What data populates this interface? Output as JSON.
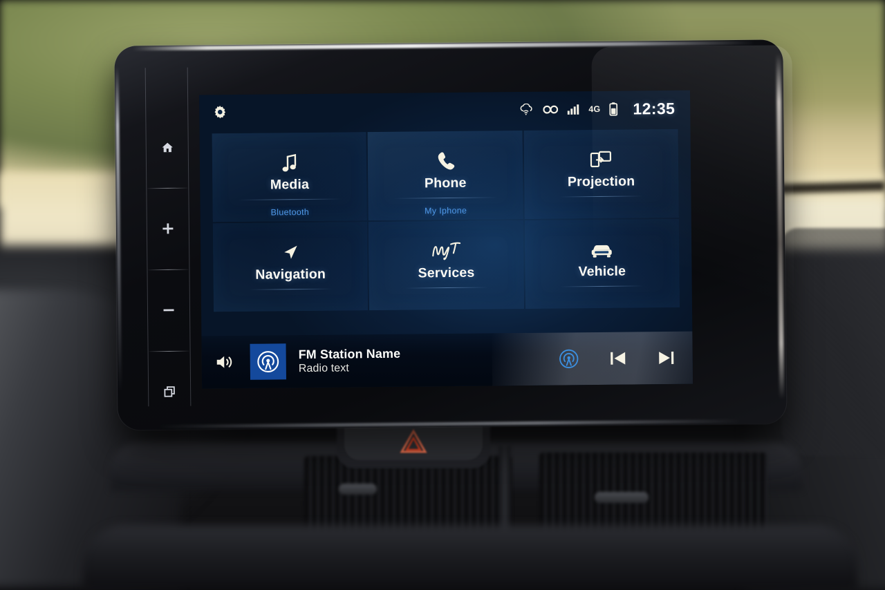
{
  "device": {
    "name": "toyota-touch-infotainment-head-unit",
    "accent_blue": "#14499c",
    "subtitle_blue": "#4f97e6",
    "icon_cream": "#f6f2e2"
  },
  "bezel": {
    "buttons": [
      {
        "name": "home",
        "icon": "home-icon",
        "label": "Home"
      },
      {
        "name": "volume-up",
        "icon": "plus-icon",
        "label": "+"
      },
      {
        "name": "volume-down",
        "icon": "minus-icon",
        "label": "−"
      },
      {
        "name": "apps",
        "icon": "apps-windows-icon",
        "label": "Apps"
      }
    ]
  },
  "statusbar": {
    "settings_icon": "gear-icon",
    "icons": [
      {
        "name": "cloud-wifi-icon",
        "title": "Connected services"
      },
      {
        "name": "bluetooth-icon",
        "title": "Bluetooth"
      },
      {
        "name": "signal-bars-icon",
        "title": "Signal strength"
      }
    ],
    "network": "4G",
    "battery_icon": "battery-icon",
    "clock": "12:35"
  },
  "grid": {
    "tiles": [
      {
        "id": "media",
        "icon": "music-note-icon",
        "title": "Media",
        "subtitle": "Bluetooth"
      },
      {
        "id": "phone",
        "icon": "phone-handset-icon",
        "title": "Phone",
        "subtitle": "My Iphone"
      },
      {
        "id": "projection",
        "icon": "screen-mirror-icon",
        "title": "Projection",
        "subtitle": ""
      },
      {
        "id": "navigation",
        "icon": "navigation-arrow-icon",
        "title": "Navigation",
        "subtitle": ""
      },
      {
        "id": "services",
        "icon": "myt-logo-icon",
        "title": "Services",
        "subtitle": ""
      },
      {
        "id": "vehicle",
        "icon": "car-front-icon",
        "title": "Vehicle",
        "subtitle": ""
      }
    ]
  },
  "mediabar": {
    "volume_icon": "volume-speaker-icon",
    "source_icon": "radio-broadcast-icon",
    "track_title": "FM Station Name",
    "track_subtitle": "Radio text",
    "controls": [
      {
        "name": "radio-source-icon",
        "label": "Radio source"
      },
      {
        "name": "previous-track-icon",
        "label": "Previous"
      },
      {
        "name": "next-track-icon",
        "label": "Next"
      }
    ]
  },
  "dashboard": {
    "hazard_button": {
      "name": "hazard-warning-button",
      "icon": "hazard-triangle-icon"
    }
  }
}
